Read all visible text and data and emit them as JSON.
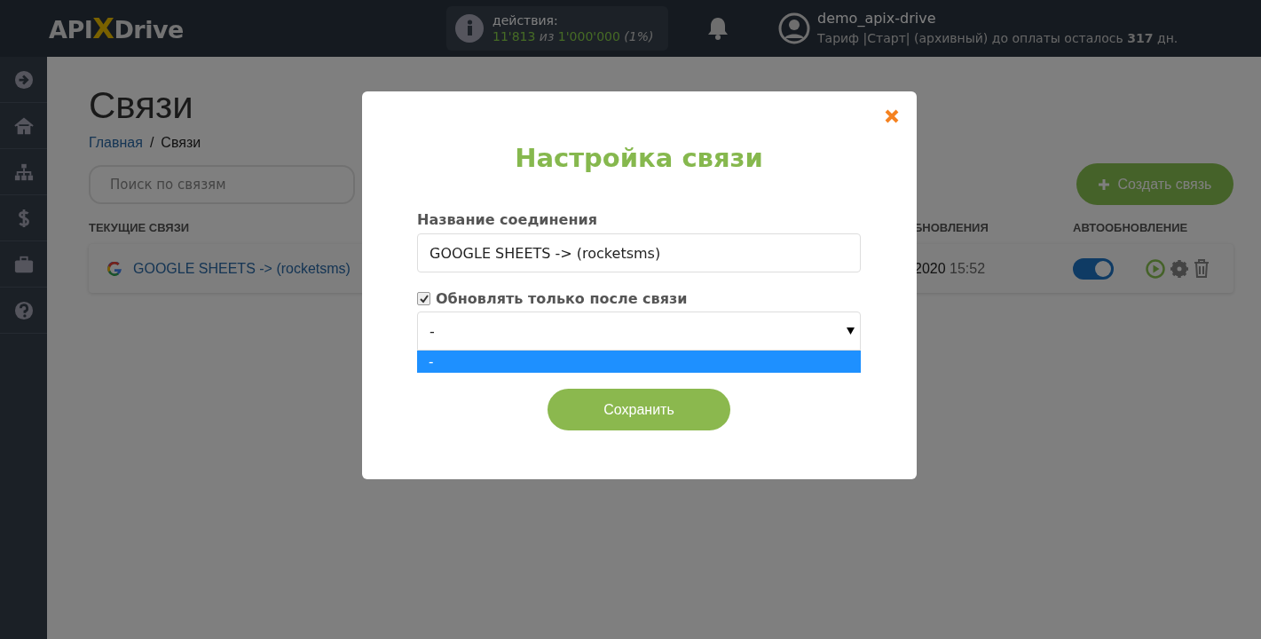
{
  "header": {
    "logo": [
      "API",
      "X",
      "Drive"
    ],
    "actions": {
      "label": "действия:",
      "used": "11'813",
      "of": "из",
      "total": "1'000'000",
      "percent": "(1%)"
    },
    "user": {
      "name": "demo_apix-drive",
      "plan": "Тариф |Старт| (архивный) до оплаты осталось **317** дн."
    }
  },
  "sidebar": {
    "items": [
      {
        "kind": "arrow"
      },
      {
        "kind": "home"
      },
      {
        "kind": "sitemap"
      },
      {
        "kind": "dollar"
      },
      {
        "kind": "briefcase"
      },
      {
        "kind": "help"
      }
    ]
  },
  "page": {
    "title": "Связи",
    "breadcrumb": [
      "Главная",
      "/",
      "Связи"
    ],
    "search": {
      "placeholder": "Поиск по связям"
    },
    "create_button": "Создать связь",
    "columns": [
      "ТЕКУЩИЕ СВЯЗИ",
      "БНОВЛЕНИЯ",
      "АВТООБНОВЛЕНИЕ"
    ],
    "rows": [
      {
        "name": "GOOGLE SHEETS -> (rocketsms)",
        "date": "2020",
        "time": "15:52",
        "autoupdate": true
      }
    ]
  },
  "modal": {
    "title": "Настройка связи",
    "field_label": "Название соединения",
    "field_value": "GOOGLE SHEETS -> (rocketsms)",
    "checkbox": {
      "label": "Обновлять только после связи",
      "checked": true
    },
    "select": {
      "value": "-",
      "options": [
        {
          "label": "-",
          "selected": true
        }
      ]
    },
    "save_button": "Сохранить"
  }
}
